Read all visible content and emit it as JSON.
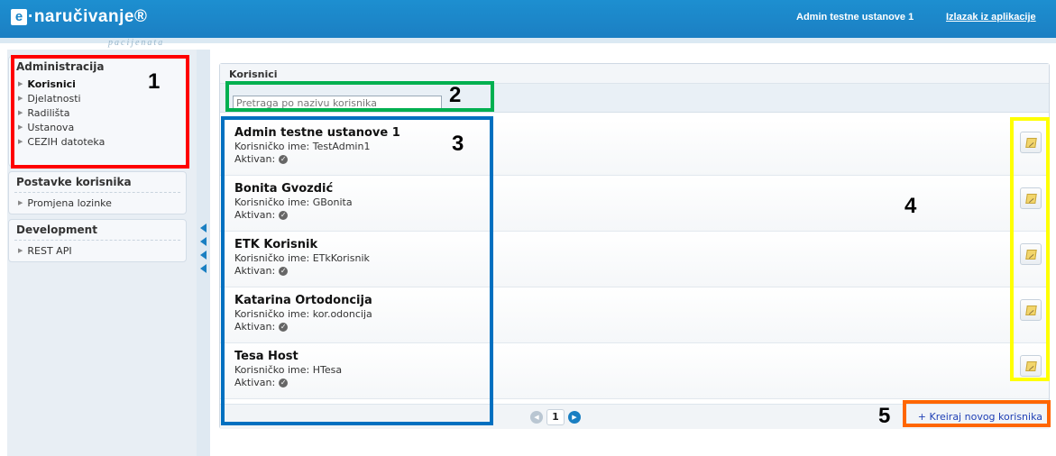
{
  "header": {
    "logo_mark": "e",
    "logo_text": "·naručivanje®",
    "logo_subtitle": "pacijenata",
    "user_name": "Admin testne ustanove 1",
    "logout_label": "Izlazak iz aplikacije"
  },
  "sidebar": {
    "sections": [
      {
        "title": "Administracija",
        "items": [
          "Korisnici",
          "Djelatnosti",
          "Radilišta",
          "Ustanova",
          "CEZIH datoteka"
        ]
      },
      {
        "title": "Postavke korisnika",
        "items": [
          "Promjena lozinke"
        ]
      },
      {
        "title": "Development",
        "items": [
          "REST API"
        ]
      }
    ]
  },
  "main": {
    "panel_title": "Korisnici",
    "search_placeholder": "Pretraga po nazivu korisnika",
    "users": [
      {
        "name": "Admin testne ustanove 1",
        "username_label": "Korisničko ime: TestAdmin1",
        "active_label": "Aktivan:"
      },
      {
        "name": "Bonita Gvozdić",
        "username_label": "Korisničko ime: GBonita",
        "active_label": "Aktivan:"
      },
      {
        "name": "ETK Korisnik",
        "username_label": "Korisničko ime: ETkKorisnik",
        "active_label": "Aktivan:"
      },
      {
        "name": "Katarina Ortodoncija",
        "username_label": "Korisničko ime: kor.odoncija",
        "active_label": "Aktivan:"
      },
      {
        "name": "Tesa Host",
        "username_label": "Korisničko ime: HTesa",
        "active_label": "Aktivan:"
      }
    ],
    "pager": {
      "current_page": "1"
    },
    "create_label": "+ Kreiraj novog korisnika"
  },
  "annotations": {
    "labels": [
      "1",
      "2",
      "3",
      "4",
      "5"
    ],
    "colors": {
      "1": "#ff0000",
      "2": "#00b050",
      "3": "#0070c0",
      "4": "#ffff00",
      "5": "#ff6600"
    }
  },
  "colors": {
    "header_blue": "#1b86c9",
    "accent_blue": "#1a7fc2"
  }
}
